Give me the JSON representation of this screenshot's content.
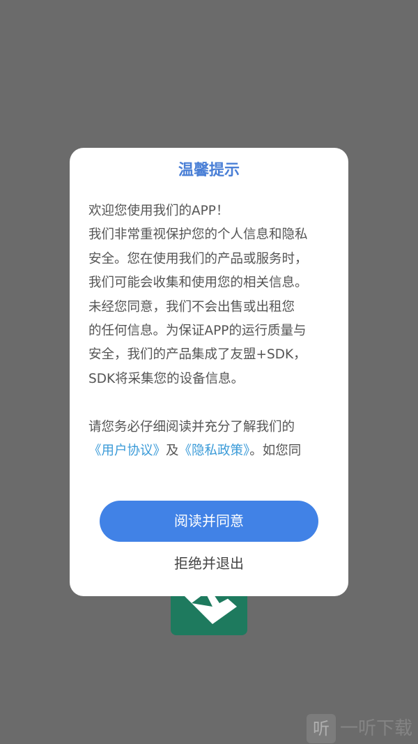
{
  "dialog": {
    "title": "温馨提示",
    "paragraph1_lines": [
      "欢迎您使用我们的APP！",
      "我们非常重视保护您的个人信息和隐私",
      "安全。您在使用我们的产品或服务时，",
      "我们可能会收集和使用您的相关信息。",
      "未经您同意，我们不会出售或出租您",
      "的任何信息。为保证APP的运行质量与",
      "安全，我们的产品集成了友盟+SDK，",
      "SDK将采集您的设备信息。"
    ],
    "paragraph2_line1": "请您务必仔细阅读并充分了解我们的",
    "user_agreement_link": "《用户协议》",
    "connector": "及",
    "privacy_policy_link": "《隐私政策》",
    "trailing_text": "。如您同",
    "agree_label": "阅读并同意",
    "reject_label": "拒绝并退出"
  },
  "watermark": {
    "icon_glyph": "听",
    "text": "一听下载"
  },
  "colors": {
    "overlay": "#6b6b6b",
    "title": "#4a7fd6",
    "link": "#3b9bd8",
    "primary_button": "#4182e6",
    "logo_bg": "#1e7a5e"
  }
}
